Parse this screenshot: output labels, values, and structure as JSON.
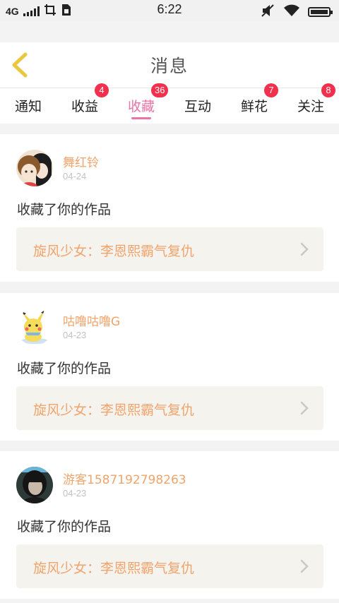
{
  "status_bar": {
    "network": "4G",
    "time": "6:22",
    "icons": [
      "signal-icon",
      "screenshot-icon",
      "sim-icon",
      "mute-icon",
      "wifi-icon",
      "battery-icon"
    ]
  },
  "header": {
    "title": "消息",
    "back_icon": "back-chevron-icon"
  },
  "tabs": [
    {
      "label": "通知",
      "badge": ""
    },
    {
      "label": "收益",
      "badge": "4"
    },
    {
      "label": "收藏",
      "badge": "36",
      "active": true
    },
    {
      "label": "互动",
      "badge": ""
    },
    {
      "label": "鲜花",
      "badge": "7"
    },
    {
      "label": "关注",
      "badge": "8"
    }
  ],
  "messages": [
    {
      "user": "舞红铃",
      "date": "04-24",
      "action": "收藏了你的作品",
      "work": "旋风少女：李恩熙霸气复仇",
      "avatar": "anime-couple-avatar"
    },
    {
      "user": "咕噜咕噜G",
      "date": "04-23",
      "action": "收藏了你的作品",
      "work": "旋风少女：李恩熙霸气复仇",
      "avatar": "pikachu-avatar"
    },
    {
      "user": "游客1587192798263",
      "date": "04-23",
      "action": "收藏了你的作品",
      "work": "旋风少女：李恩熙霸气复仇",
      "avatar": "portrait-avatar"
    }
  ],
  "colors": {
    "accent_pink": "#ea74a8",
    "name_orange": "#f0a46b",
    "badge_red": "#f1304d",
    "back_yellow": "#e8c840"
  }
}
